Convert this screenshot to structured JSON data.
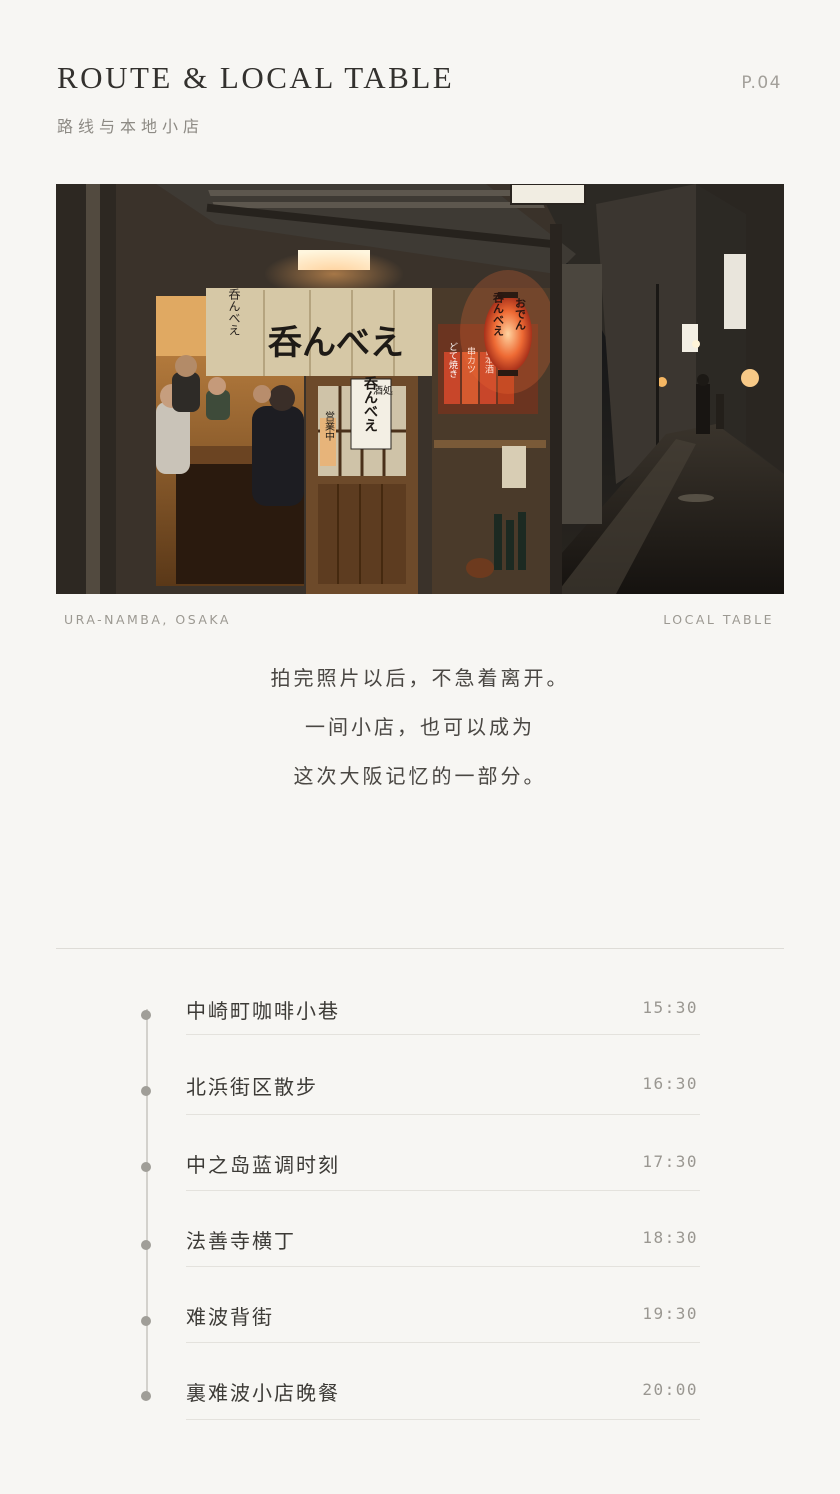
{
  "header": {
    "title": "ROUTE & LOCAL TABLE",
    "subtitle": "路线与本地小店",
    "page": "P.04"
  },
  "photo": {
    "curtain_text": "呑んべえ",
    "curtain_small": "呑んべえ",
    "lantern_text": "おでん",
    "lantern_text2": "呑んべえ",
    "door_sign_small": "酒処",
    "door_sign": "呑んべえ",
    "open_sign": "営業中",
    "menu_tags": [
      "どて焼き",
      "串カツ",
      "日本酒",
      "焼鳥"
    ]
  },
  "caption": {
    "location": "URA-NAMBA, OSAKA",
    "tag": "LOCAL TABLE"
  },
  "poem": {
    "lines": [
      "拍完照片以后，不急着离开。",
      "一间小店，也可以成为",
      "这次大阪记忆的一部分。"
    ]
  },
  "route": {
    "items": [
      {
        "name": "中崎町咖啡小巷",
        "time": "15:30"
      },
      {
        "name": "北浜街区散步",
        "time": "16:30"
      },
      {
        "name": "中之岛蓝调时刻",
        "time": "17:30"
      },
      {
        "name": "法善寺横丁",
        "time": "18:30"
      },
      {
        "name": "难波背街",
        "time": "19:30"
      },
      {
        "name": "裏难波小店晚餐",
        "time": "20:00"
      }
    ]
  },
  "colors": {
    "background": "#f7f6f3",
    "text": "#3d3b37",
    "muted": "#9a9791",
    "lantern": "#e8542a"
  }
}
